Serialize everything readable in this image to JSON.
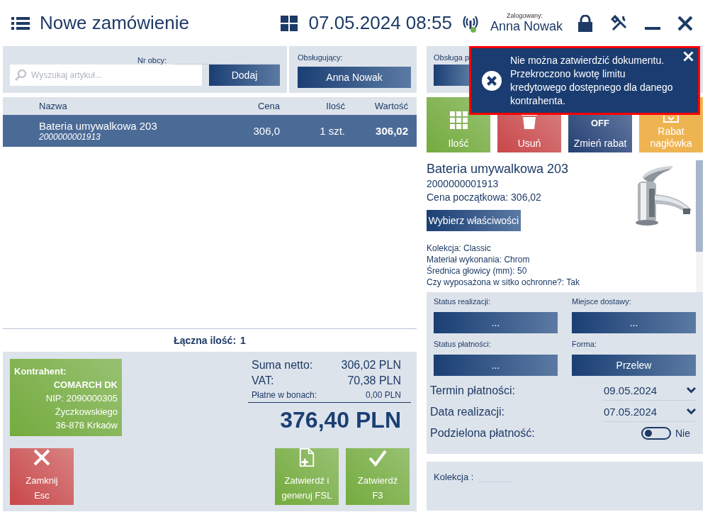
{
  "header": {
    "title": "Nowe zamówienie",
    "datetime": "07.05.2024 08:55",
    "logged_label": "Zalogowany:",
    "user": "Anna Nowak"
  },
  "search_panel": {
    "foreign_no_label": "Nr obcy:",
    "search_placeholder": "Wyszukaj artykuł...",
    "add_button": "Dodaj"
  },
  "operator_panel": {
    "label": "Obsługujący:",
    "value": "Anna Nowak"
  },
  "service_panel": {
    "label": "Obsługa p"
  },
  "table": {
    "columns": [
      "Nazwa",
      "Cena",
      "Ilość",
      "Wartość"
    ],
    "rows": [
      {
        "name": "Bateria umywalkowa 203",
        "code": "2000000001913",
        "price": "306,0",
        "quantity": "1 szt.",
        "value": "306,02",
        "selected": true
      }
    ]
  },
  "total_quantity": {
    "label": "Łączna ilość:",
    "value": "1"
  },
  "contractor": {
    "label": "Kontrahent:",
    "name": "COMARCH DK",
    "lines": [
      "NIP: 2090000305",
      "Życzkowskiego",
      "36-878 Krkaów"
    ]
  },
  "totals": {
    "rows": [
      {
        "kind": "main",
        "label": "Suma netto:",
        "value": "306,02 PLN"
      },
      {
        "kind": "main",
        "label": "VAT:",
        "value": "70,38 PLN"
      },
      {
        "kind": "small",
        "label": "Płatne w bonach:",
        "value": "0,00 PLN"
      }
    ],
    "grand_total": "376,40 PLN"
  },
  "bottom_buttons": [
    {
      "kind": "close",
      "lines": [
        "Zamknij",
        "Esc"
      ]
    },
    {
      "kind": "confirm-generate",
      "lines": [
        "Zatwierdź i",
        "generuj FSL"
      ]
    },
    {
      "kind": "confirm",
      "lines": [
        "Zatwierdź",
        "F3"
      ]
    }
  ],
  "tiles": [
    {
      "kind": "quantity",
      "label": "Ilość"
    },
    {
      "kind": "delete",
      "label": "Usuń"
    },
    {
      "kind": "discount",
      "icon_text": "OFF",
      "label": "Zmień rabat"
    },
    {
      "kind": "header-discount",
      "label": "Rabat nagłówka"
    }
  ],
  "product": {
    "name": "Bateria umywalkowa 203",
    "code": "2000000001913",
    "initial_price": "Cena początkowa: 306,02",
    "properties_button": "Wybierz właściwości",
    "attributes": [
      "Kolekcja: Classic",
      "Materiał wykonania: Chrom",
      "Średnica głowicy (mm): 50",
      "Czy wyposażona w sitko ochronne?: Tak"
    ]
  },
  "order_form": {
    "selectors": [
      {
        "label": "Status realizacji:",
        "value": "..."
      },
      {
        "label": "Miejsce dostawy:",
        "value": "..."
      },
      {
        "label": "Status płatności:",
        "value": "..."
      },
      {
        "label": "Forma:",
        "value": "Przelew"
      }
    ],
    "date_fields": [
      {
        "label": "Termin płatności:",
        "value": "09.05.2024"
      },
      {
        "label": "Data realizacji:",
        "value": "07.05.2024"
      }
    ],
    "split_payment": {
      "label": "Podzielona płatność:",
      "on": false,
      "value": "Nie"
    }
  },
  "collection_panel": {
    "label": "Kolekcja :"
  },
  "notification": {
    "lines": [
      "Nie można zatwierdzić dokumentu.",
      "Przekroczono kwotę limitu",
      "kredytowego dostępnego dla danego",
      "kontrahenta."
    ]
  }
}
